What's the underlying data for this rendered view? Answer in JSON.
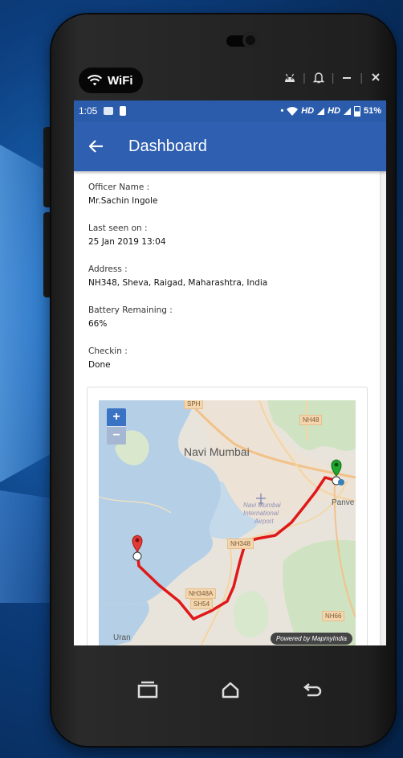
{
  "device": {
    "wifi_label": "WiFi"
  },
  "statusbar": {
    "time": "1:05",
    "network_1": "HD",
    "network_2": "HD",
    "battery": "51%"
  },
  "appbar": {
    "title": "Dashboard"
  },
  "details": [
    {
      "label": "Officer Name :",
      "value": "Mr.Sachin Ingole"
    },
    {
      "label": "Last seen on :",
      "value": "25 Jan 2019 13:04"
    },
    {
      "label": "Address :",
      "value": "NH348, Sheva, Raigad, Maharashtra, India"
    },
    {
      "label": "Battery Remaining :",
      "value": "66%"
    },
    {
      "label": "Checkin :",
      "value": "Done"
    }
  ],
  "map": {
    "city_label": "Navi Mumbai",
    "airport_label_1": "Navi Mumbai",
    "airport_label_2": "International",
    "airport_label_3": "Airport",
    "place_panvel": "Panve",
    "place_uran": "Uran",
    "road_sph": "SPH",
    "road_nh48": "NH48",
    "road_nh348": "NH348",
    "road_nh348a": "NH348A",
    "road_sh54": "SH54",
    "road_nh66": "NH66",
    "zoom_in": "+",
    "zoom_out": "−",
    "attribution": "Powered by MapmyIndia",
    "route_color": "#e01818",
    "start_marker_color": "#e53935",
    "end_marker_color": "#1fa82c"
  },
  "navbar": {
    "recents_icon": "recents-icon",
    "home_icon": "home-icon",
    "back_icon": "back-icon"
  }
}
